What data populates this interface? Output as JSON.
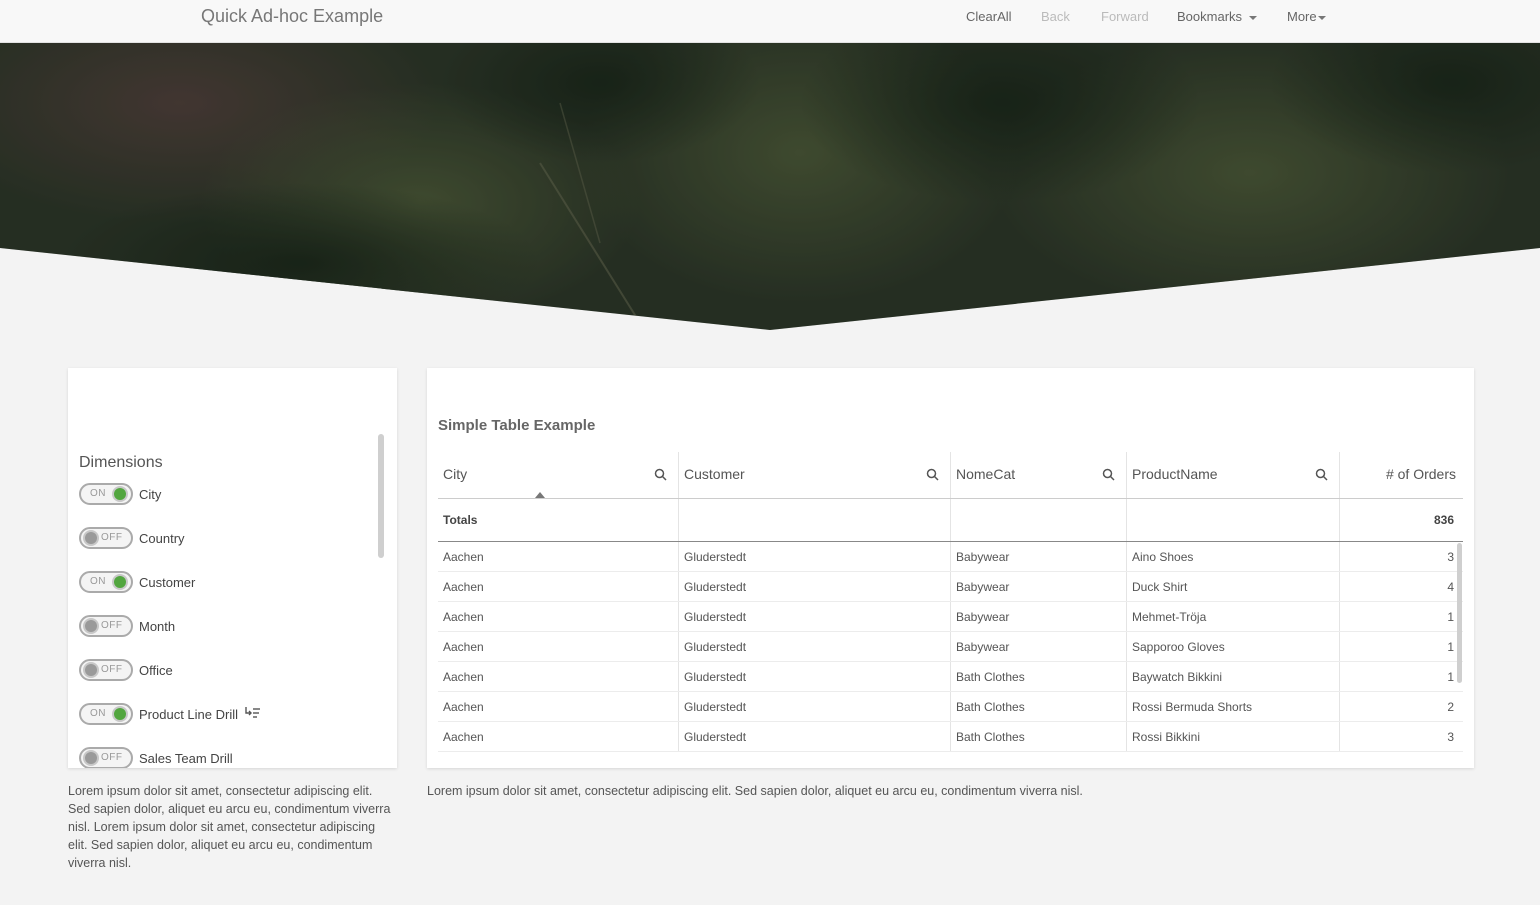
{
  "navbar": {
    "brand": "Quick Ad-hoc Example",
    "clear_all": "ClearAll",
    "back": "Back",
    "forward": "Forward",
    "bookmarks": "Bookmarks",
    "more": "More"
  },
  "dimensions": {
    "title": "Dimensions",
    "items": [
      {
        "name": "City",
        "state": "ON"
      },
      {
        "name": "Country",
        "state": "OFF"
      },
      {
        "name": "Customer",
        "state": "ON"
      },
      {
        "name": "Month",
        "state": "OFF"
      },
      {
        "name": "Office",
        "state": "OFF"
      },
      {
        "name": "Product Line Drill",
        "state": "ON"
      },
      {
        "name": "Sales Team Drill",
        "state": "OFF"
      }
    ]
  },
  "table": {
    "title": "Simple Table Example",
    "columns": [
      "City",
      "Customer",
      "NomeCat",
      "ProductName",
      "# of Orders"
    ],
    "totals_label": "Totals",
    "totals_value": "836",
    "rows": [
      [
        "Aachen",
        "Gluderstedt",
        "Babywear",
        "Aino Shoes",
        "3"
      ],
      [
        "Aachen",
        "Gluderstedt",
        "Babywear",
        "Duck Shirt",
        "4"
      ],
      [
        "Aachen",
        "Gluderstedt",
        "Babywear",
        "Mehmet-Tröja",
        "1"
      ],
      [
        "Aachen",
        "Gluderstedt",
        "Babywear",
        "Sapporoo Gloves",
        "1"
      ],
      [
        "Aachen",
        "Gluderstedt",
        "Bath Clothes",
        "Baywatch Bikkini",
        "1"
      ],
      [
        "Aachen",
        "Gluderstedt",
        "Bath Clothes",
        "Rossi Bermuda Shorts",
        "2"
      ],
      [
        "Aachen",
        "Gluderstedt",
        "Bath Clothes",
        "Rossi Bikkini",
        "3"
      ]
    ]
  },
  "lorem_left": "Lorem ipsum dolor sit amet, consectetur adipiscing elit. Sed sapien dolor, aliquet eu arcu eu, condimentum viverra nisl. Lorem ipsum dolor sit amet, consectetur adipiscing elit. Sed sapien dolor, aliquet eu arcu eu, condimentum viverra nisl.",
  "lorem_right": "Lorem ipsum dolor sit amet, consectetur adipiscing elit. Sed sapien dolor, aliquet eu arcu eu, condimentum viverra nisl.",
  "icons": {
    "search": "search-icon",
    "drill": "drill-down-icon",
    "caret": "caret-down-icon"
  },
  "colors": {
    "toggle_on": "#52a63f",
    "background": "#f3f3f3",
    "hero": "#2f3a2b"
  }
}
